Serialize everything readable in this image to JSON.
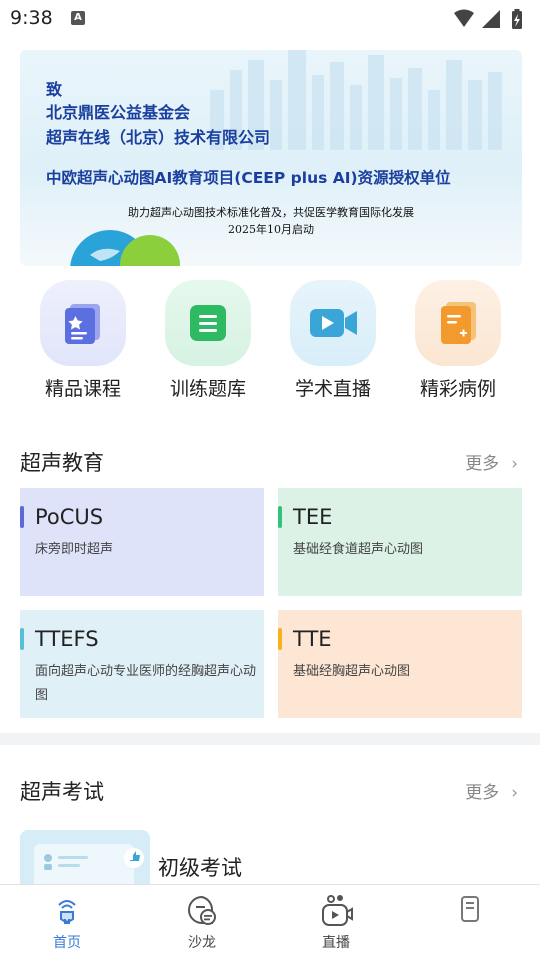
{
  "status_bar": {
    "time": "9:38",
    "a_icon": "A"
  },
  "banner": {
    "line1": "致",
    "line2": "北京鼎医公益基金会",
    "line3": "超声在线（北京）技术有限公司",
    "line4": "中欧超声心动图AI教育项目(CEEP plus AI)资源授权单位",
    "line5": "助力超声心动图技术标准化普及，共促医学教育国际化发展",
    "line6": "2025年10月启动"
  },
  "quick_entries": [
    {
      "label": "精品课程",
      "icon": "course-card-icon",
      "color": "#5b6fe0"
    },
    {
      "label": "训练题库",
      "icon": "question-bank-icon",
      "color": "#2dba62"
    },
    {
      "label": "学术直播",
      "icon": "live-video-icon",
      "color": "#3aa6d8"
    },
    {
      "label": "精彩病例",
      "icon": "case-file-icon",
      "color": "#f29a2e"
    }
  ],
  "education": {
    "title": "超声教育",
    "more": "更多",
    "cards": [
      {
        "title": "PoCUS",
        "subtitle": "床旁即时超声",
        "bg": "#dfe3f9",
        "bar": "#5a6bd6"
      },
      {
        "title": "TEE",
        "subtitle": "基础经食道超声心动图",
        "bg": "#dcf2e6",
        "bar": "#33c27a"
      },
      {
        "title": "TTEFS",
        "subtitle": "面向超声心动专业医师的经胸超声心动图",
        "bg": "#dff0f6",
        "bar": "#55bfd6"
      },
      {
        "title": "TTE",
        "subtitle": "基础经胸超声心动图",
        "bg": "#fde6d3",
        "bar": "#f5b21a"
      }
    ]
  },
  "exam": {
    "title": "超声考试",
    "more": "更多",
    "item_title": "初级考试"
  },
  "tabbar": [
    {
      "label": "首页",
      "icon": "home-icon",
      "active": true
    },
    {
      "label": "沙龙",
      "icon": "salon-chat-icon",
      "active": false
    },
    {
      "label": "直播",
      "icon": "live-icon",
      "active": false
    },
    {
      "label": "",
      "icon": "profile-icon",
      "active": false
    }
  ]
}
